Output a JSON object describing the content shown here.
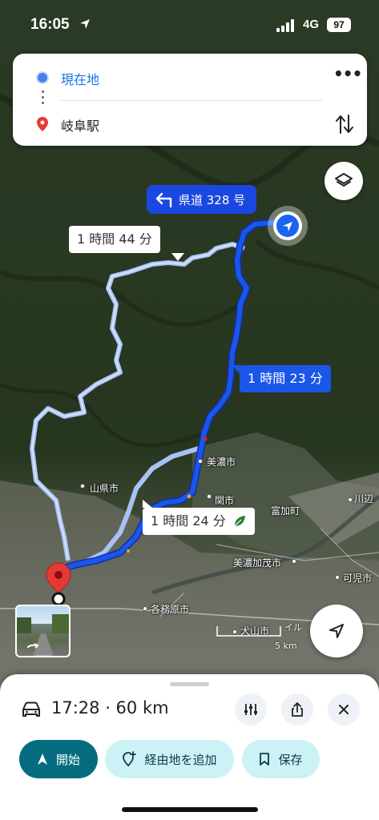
{
  "status": {
    "time": "16:05",
    "network": "4G",
    "battery": "97"
  },
  "route_card": {
    "origin": "現在地",
    "destination": "岐阜駅"
  },
  "map": {
    "direction_chip": "県道 328 号",
    "routes": {
      "selected": "1 時間 23 分",
      "alternative_1": "1 時間 24 分",
      "alternative_2": "1 時間 44 分"
    },
    "places": {
      "mino": "美濃市",
      "seki": "関市",
      "tomika": "富加町",
      "yamagata": "山県市",
      "minokamo": "美濃加茂市",
      "kakamigahara": "各務原市",
      "inuyama": "犬山市",
      "kani": "可児市",
      "kawabe": "川辺"
    },
    "scale": {
      "mi": "イル",
      "km": "5 km"
    }
  },
  "sheet": {
    "summary": "17:28 · 60 km",
    "start_label": "開始",
    "add_stop_label": "経由地を追加",
    "save_label": "保存"
  },
  "colors": {
    "selected_route": "#1a56e8",
    "alternative_route": "#a9c2f5",
    "start_button": "#046c7e",
    "secondary_button": "#cdf2f6"
  }
}
